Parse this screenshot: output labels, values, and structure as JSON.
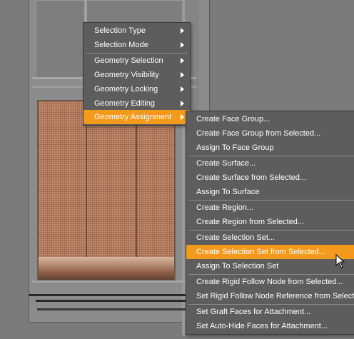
{
  "main_menu": {
    "items": [
      {
        "label": "Selection Type",
        "has_submenu": true,
        "highlighted": false
      },
      {
        "label": "Selection Mode",
        "has_submenu": true,
        "highlighted": false
      },
      {
        "label": "Geometry Selection",
        "has_submenu": true,
        "highlighted": false
      },
      {
        "label": "Geometry Visibility",
        "has_submenu": true,
        "highlighted": false
      },
      {
        "label": "Geometry Locking",
        "has_submenu": true,
        "highlighted": false
      },
      {
        "label": "Geometry Editing",
        "has_submenu": true,
        "highlighted": false
      },
      {
        "label": "Geometry Assignment",
        "has_submenu": true,
        "highlighted": true
      }
    ]
  },
  "submenu": {
    "items": [
      {
        "label": "Create Face Group..."
      },
      {
        "label": "Create Face Group from Selected..."
      },
      {
        "label": "Assign To Face Group"
      },
      {
        "label": "Create Surface..."
      },
      {
        "label": "Create Surface from Selected..."
      },
      {
        "label": "Assign To Surface"
      },
      {
        "label": "Create Region..."
      },
      {
        "label": "Create Region from Selected..."
      },
      {
        "label": "Create Selection Set..."
      },
      {
        "label": "Create Selection Set from Selected...",
        "highlighted": true
      },
      {
        "label": "Assign To Selection Set"
      },
      {
        "label": "Create Rigid Follow Node from Selected..."
      },
      {
        "label": "Set Rigid Follow Node Reference from Selecte"
      },
      {
        "label": "Set Graft Faces for Attachment..."
      },
      {
        "label": "Set Auto-Hide Faces for Attachment..."
      }
    ]
  },
  "colors": {
    "menu_bg": "#5d5d5d",
    "highlight": "#f39a1c",
    "text": "#ffffff",
    "viewport_bg": "#7b7b7b"
  }
}
